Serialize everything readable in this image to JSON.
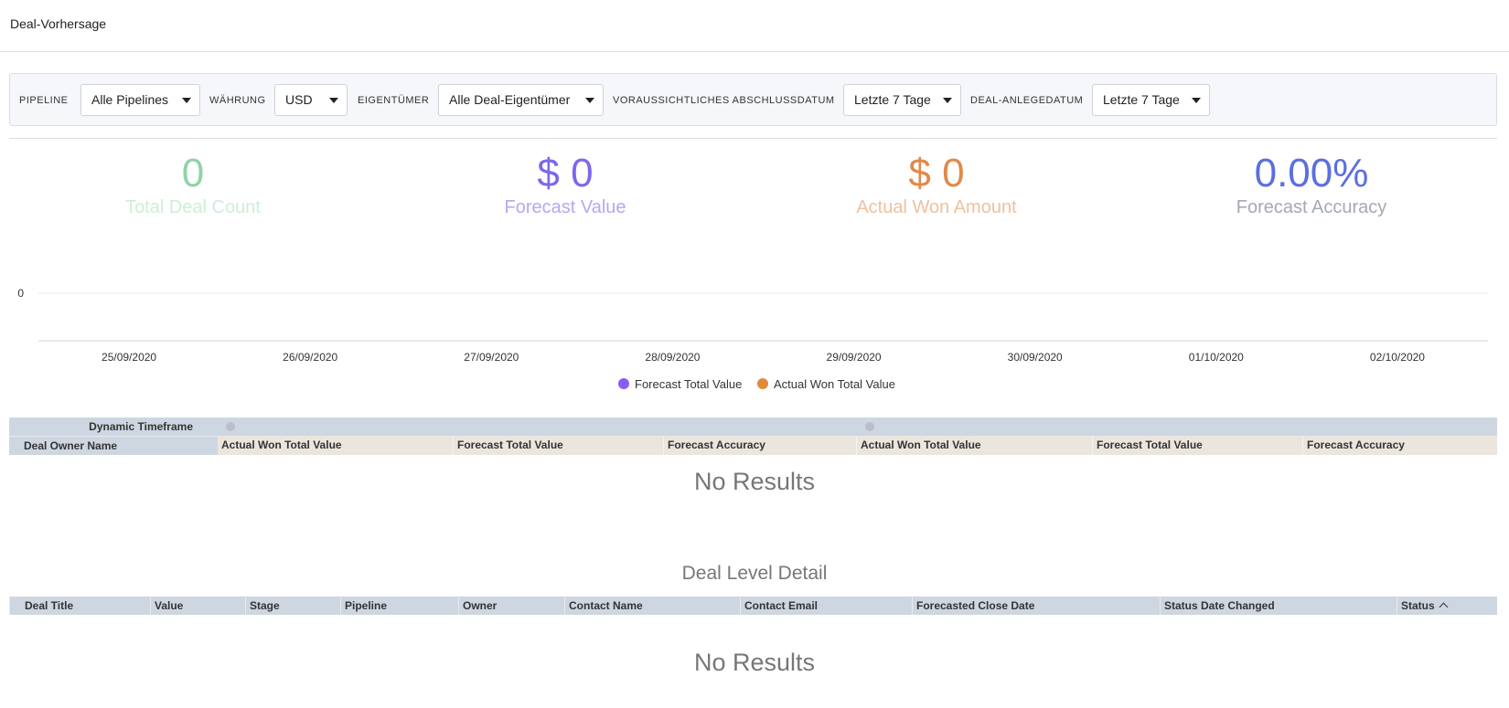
{
  "header": {
    "title": "Deal-Vorhersage"
  },
  "filters": [
    {
      "label": "PIPELINE",
      "value": "Alle Pipelines"
    },
    {
      "label": "WÄHRUNG",
      "value": "USD"
    },
    {
      "label": "EIGENTÜMER",
      "value": "Alle Deal-Eigentümer"
    },
    {
      "label": "VORAUSSICHTLICHES ABSCHLUSSDATUM",
      "value": "Letzte 7 Tage"
    },
    {
      "label": "DEAL-ANLEGEDATUM",
      "value": "Letzte 7 Tage"
    }
  ],
  "kpis": [
    {
      "value": "0",
      "label": "Total Deal Count",
      "color": "#8fd3a8",
      "label_color": "#cdeed8"
    },
    {
      "value": "$ 0",
      "label": "Forecast Value",
      "color": "#7b68ee",
      "label_color": "#b3a9f3"
    },
    {
      "value": "$ 0",
      "label": "Actual Won Amount",
      "color": "#e08a4a",
      "label_color": "#f0c1a0"
    },
    {
      "value": "0.00%",
      "label": "Forecast Accuracy",
      "color": "#5a6fe0",
      "label_color": "#a4a9b4"
    }
  ],
  "chart_data": {
    "type": "line",
    "x": [
      "25/09/2020",
      "26/09/2020",
      "27/09/2020",
      "28/09/2020",
      "29/09/2020",
      "30/09/2020",
      "01/10/2020",
      "02/10/2020"
    ],
    "yticks": [
      "0"
    ],
    "series": [
      {
        "name": "Forecast Total Value",
        "color": "#8a5cf5",
        "values": [
          0,
          0,
          0,
          0,
          0,
          0,
          0,
          0
        ]
      },
      {
        "name": "Actual Won Total Value",
        "color": "#e08a3a",
        "values": [
          0,
          0,
          0,
          0,
          0,
          0,
          0,
          0
        ]
      }
    ],
    "grid": true,
    "legend": "bottom"
  },
  "forecast_table": {
    "group_label": "Dynamic Timeframe",
    "owner_header": "Deal Owner Name",
    "columns": [
      "Actual Won Total Value",
      "Forecast Total Value",
      "Forecast Accuracy",
      "Actual Won Total Value",
      "Forecast Total Value",
      "Forecast Accuracy"
    ],
    "empty_text": "No Results"
  },
  "detail": {
    "title": "Deal Level Detail",
    "columns": [
      "Deal Title",
      "Value",
      "Stage",
      "Pipeline",
      "Owner",
      "Contact Name",
      "Contact Email",
      "Forecasted Close Date",
      "Status Date Changed",
      "Status"
    ],
    "empty_text": "No Results"
  }
}
